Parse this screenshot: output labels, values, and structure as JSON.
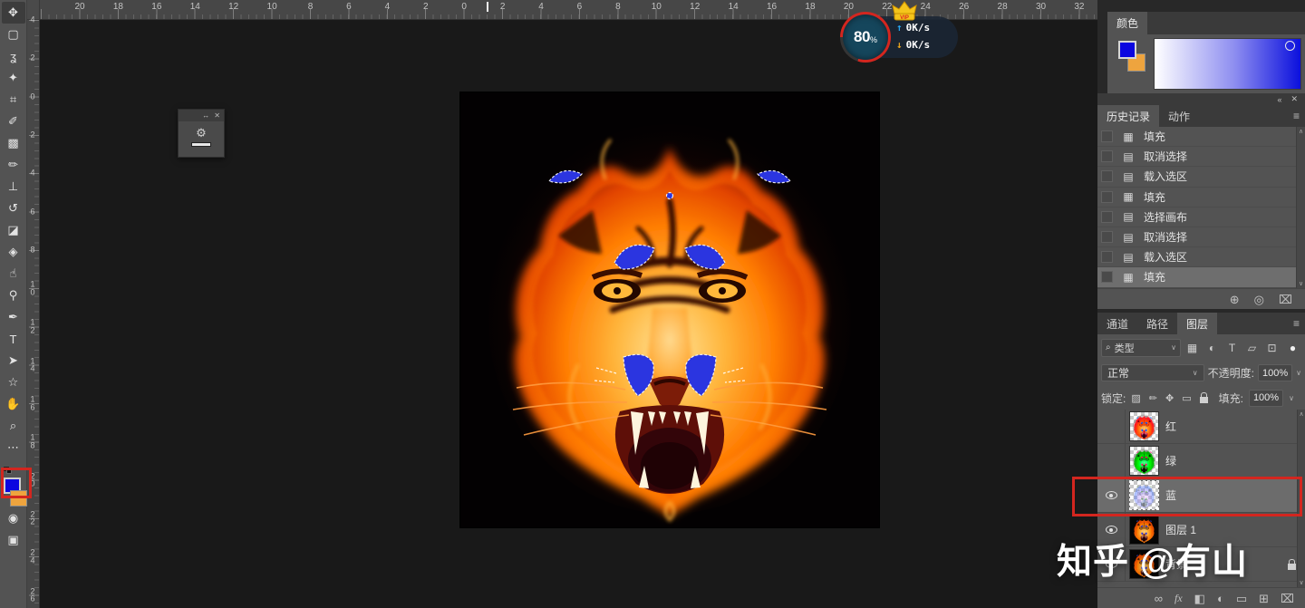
{
  "colors": {
    "accent_red": "#d3261f",
    "foreground_blue": "#0b06e0",
    "background_orange": "#eea43e"
  },
  "overlay": {
    "zoom_value": "80",
    "zoom_unit": "%",
    "vip_label": "VIP",
    "upload_speed": "0K/s",
    "download_speed": "0K/s"
  },
  "rulers": {
    "horizontal_labels": [
      "20",
      "18",
      "16",
      "14",
      "12",
      "10",
      "8",
      "6",
      "4",
      "2",
      "0",
      "2",
      "4",
      "6",
      "8",
      "10",
      "12",
      "14",
      "16",
      "18",
      "20",
      "22",
      "24",
      "26",
      "28",
      "30",
      "32"
    ],
    "vertical_labels": [
      "4",
      "2",
      "0",
      "2",
      "4",
      "6",
      "8",
      "10",
      "12",
      "14",
      "16",
      "18",
      "20",
      "22",
      "24",
      "26"
    ]
  },
  "toolbar": {
    "tools": [
      {
        "name": "move-tool",
        "glyph": "✥",
        "selected": true
      },
      {
        "name": "marquee-tool",
        "glyph": "▢",
        "selected": false
      },
      {
        "name": "lasso-tool",
        "glyph": "ʓ",
        "selected": false
      },
      {
        "name": "quick-selection-tool",
        "glyph": "✦",
        "selected": false
      },
      {
        "name": "crop-tool",
        "glyph": "⌗",
        "selected": false
      },
      {
        "name": "eyedropper-tool",
        "glyph": "✐",
        "selected": false
      },
      {
        "name": "healing-brush-tool",
        "glyph": "▩",
        "selected": false
      },
      {
        "name": "brush-tool",
        "glyph": "✏",
        "selected": false
      },
      {
        "name": "clone-stamp-tool",
        "glyph": "⊥",
        "selected": false
      },
      {
        "name": "history-brush-tool",
        "glyph": "↺",
        "selected": false
      },
      {
        "name": "eraser-tool",
        "glyph": "◪",
        "selected": false
      },
      {
        "name": "gradient-tool",
        "glyph": "◈",
        "selected": false
      },
      {
        "name": "smudge-tool",
        "glyph": "☝",
        "selected": false
      },
      {
        "name": "dodge-tool",
        "glyph": "⚲",
        "selected": false
      },
      {
        "name": "pen-tool",
        "glyph": "✒",
        "selected": false
      },
      {
        "name": "type-tool",
        "glyph": "T",
        "selected": false
      },
      {
        "name": "path-selection-tool",
        "glyph": "➤",
        "selected": false
      },
      {
        "name": "custom-shape-tool",
        "glyph": "☆",
        "selected": false
      },
      {
        "name": "hand-tool",
        "glyph": "✋",
        "selected": false
      },
      {
        "name": "zoom-tool",
        "glyph": "⌕",
        "selected": false
      },
      {
        "name": "more-tools",
        "glyph": "⋯",
        "selected": false
      }
    ],
    "quick_mask_glyph": "◉",
    "screen_mode_glyph": "▣"
  },
  "mini_window": {
    "collapse_icon": "↔",
    "close_icon": "✕",
    "body_icon": "⚙"
  },
  "color_panel": {
    "tab_label": "颜色"
  },
  "group_header": {
    "collapse_icon": "«",
    "close_icon": "✕"
  },
  "history_panel": {
    "tab_history": "历史记录",
    "tab_actions": "动作",
    "menu_icon": "≡",
    "scroll_up": "∧",
    "scroll_down": "∨",
    "items": [
      {
        "label": "填充",
        "icon": "fill-icon",
        "glyph": "▦",
        "selected": false
      },
      {
        "label": "取消选择",
        "icon": "document-icon",
        "glyph": "▤",
        "selected": false
      },
      {
        "label": "载入选区",
        "icon": "document-icon",
        "glyph": "▤",
        "selected": false
      },
      {
        "label": "填充",
        "icon": "fill-icon",
        "glyph": "▦",
        "selected": false
      },
      {
        "label": "选择画布",
        "icon": "document-icon",
        "glyph": "▤",
        "selected": false
      },
      {
        "label": "取消选择",
        "icon": "document-icon",
        "glyph": "▤",
        "selected": false
      },
      {
        "label": "载入选区",
        "icon": "document-icon",
        "glyph": "▤",
        "selected": false
      },
      {
        "label": "填充",
        "icon": "fill-icon",
        "glyph": "▦",
        "selected": true
      }
    ],
    "footer_icons": [
      {
        "name": "new-document-from-state-icon",
        "glyph": "⊕"
      },
      {
        "name": "new-snapshot-icon",
        "glyph": "◎"
      },
      {
        "name": "delete-state-icon",
        "glyph": "⌧"
      }
    ]
  },
  "layers_panel": {
    "tab_channels": "通道",
    "tab_paths": "路径",
    "tab_layers": "图层",
    "menu_icon": "≡",
    "filter_label": "类型",
    "filter_search_glyph": "⌕",
    "filter_icons": [
      {
        "name": "filter-pixel-icon",
        "glyph": "▦"
      },
      {
        "name": "filter-adjustment-icon",
        "glyph": "◐"
      },
      {
        "name": "filter-type-icon",
        "glyph": "T"
      },
      {
        "name": "filter-shape-icon",
        "glyph": "▱"
      },
      {
        "name": "filter-smart-object-icon",
        "glyph": "⊡"
      },
      {
        "name": "filter-toggle-icon",
        "glyph": "●"
      }
    ],
    "blend_mode": "正常",
    "opacity_label": "不透明度:",
    "opacity_value": "100%",
    "lock_label": "锁定:",
    "lock_icons": [
      {
        "name": "lock-transparent-pixels-icon",
        "glyph": "▨"
      },
      {
        "name": "lock-image-pixels-icon",
        "glyph": "✏"
      },
      {
        "name": "lock-position-icon",
        "glyph": "✥"
      },
      {
        "name": "lock-artboard-icon",
        "glyph": "▭"
      },
      {
        "name": "lock-all-icon",
        "glyph": "lock"
      }
    ],
    "fill_label": "填充:",
    "fill_value": "100%",
    "layers": [
      {
        "name": "红",
        "visible": false,
        "thumb": "red",
        "transparent": true,
        "selected": false,
        "locked": false
      },
      {
        "name": "绿",
        "visible": false,
        "thumb": "green",
        "transparent": true,
        "selected": false,
        "locked": false
      },
      {
        "name": "蓝",
        "visible": true,
        "thumb": "blue",
        "transparent": true,
        "selected": true,
        "locked": false
      },
      {
        "name": "图层 1",
        "visible": true,
        "thumb": "orange",
        "transparent": false,
        "selected": false,
        "locked": false
      },
      {
        "name": "背景",
        "visible": true,
        "thumb": "orange",
        "transparent": false,
        "selected": false,
        "locked": true
      }
    ],
    "scroll_up": "∧",
    "scroll_down": "∨",
    "footer_icons": [
      {
        "name": "link-layers-icon",
        "glyph": "∞"
      },
      {
        "name": "layer-effects-icon",
        "glyph": "fx"
      },
      {
        "name": "layer-mask-icon",
        "glyph": "◧"
      },
      {
        "name": "adjustment-layer-icon",
        "glyph": "◐"
      },
      {
        "name": "layer-group-icon",
        "glyph": "▭"
      },
      {
        "name": "new-layer-icon",
        "glyph": "⊞"
      },
      {
        "name": "delete-layer-icon",
        "glyph": "⌧"
      }
    ]
  },
  "watermark": {
    "text": "知乎 @有山"
  }
}
